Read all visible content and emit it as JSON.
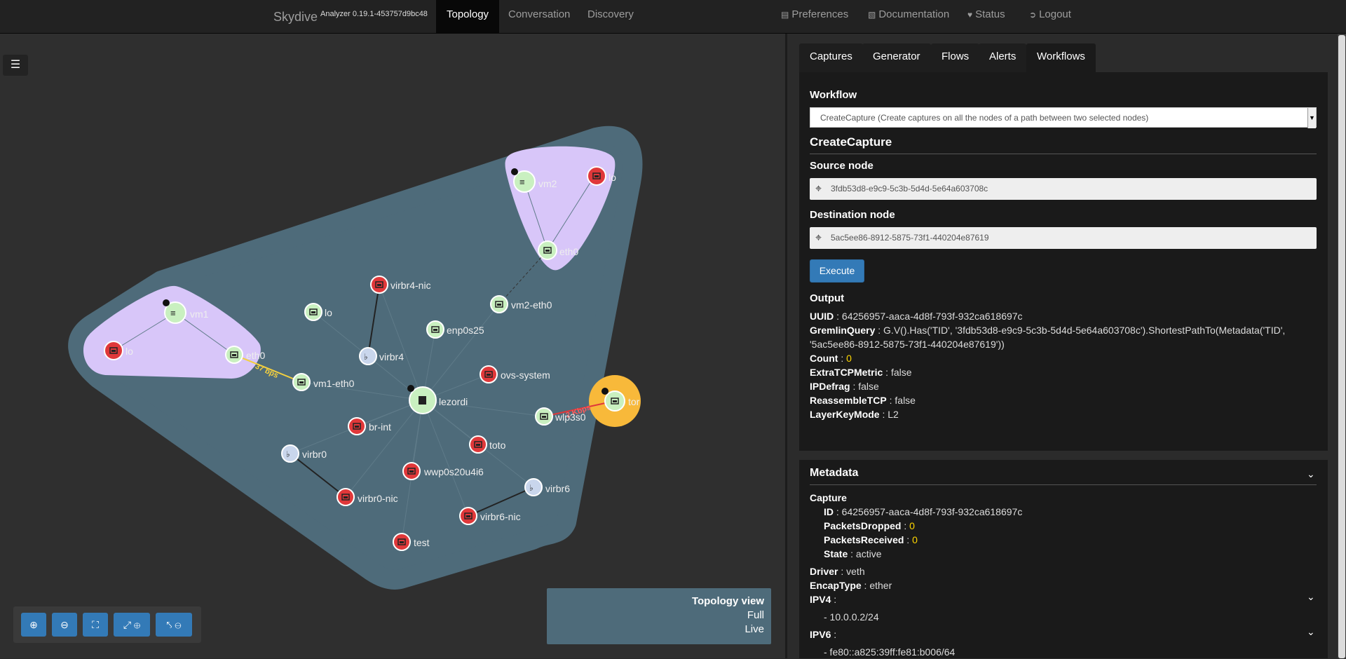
{
  "nav": {
    "brand": "Skydive",
    "version": "Analyzer 0.19.1-453757d9bc48",
    "tabs": [
      "Topology",
      "Conversation",
      "Discovery"
    ],
    "right": [
      {
        "icon": "preferences-icon",
        "label": "Preferences"
      },
      {
        "icon": "documentation-icon",
        "label": "Documentation"
      },
      {
        "icon": "status-icon",
        "label": "Status"
      },
      {
        "icon": "logout-icon",
        "label": "Logout"
      }
    ]
  },
  "topology": {
    "nodes": {
      "vm2": "vm2",
      "lo_vm2": "lo",
      "eth0_vm2": "eth0",
      "vm2_eth0": "vm2-eth0",
      "vm1": "vm1",
      "lo_vm1": "lo",
      "eth0_vm1": "eth0",
      "virbr4_nic": "virbr4-nic",
      "lo_host": "lo",
      "virbr4": "virbr4",
      "enp0s25": "enp0s25",
      "vm1_eth0": "vm1-eth0",
      "lezordi": "lezordi",
      "ovs_system": "ovs-system",
      "br_int": "br-int",
      "toto": "toto",
      "wlp3s0": "wlp3s0",
      "tor": "tor",
      "virbr0": "virbr0",
      "wwp0s20u4i6": "wwp0s20u4i6",
      "virbr0_nic": "virbr0-nic",
      "virbr6": "virbr6",
      "virbr6_nic": "virbr6-nic",
      "test": "test"
    },
    "link_labels": {
      "vm1_rate": "37 bps",
      "tor_rate": "2 Kbps"
    },
    "colors": {
      "hull": "#4e6b7a",
      "vm_group": "#d8c6f9",
      "tor_group": "#f8b93a",
      "interface_down": "#e0383a",
      "interface_up": "#c9f0c0",
      "bridge": "#c9d6ec"
    }
  },
  "zoom_controls": [
    "zoom-in-icon",
    "zoom-out-icon",
    "fit-icon",
    "expand-all-icon",
    "collapse-all-icon"
  ],
  "legend": {
    "title": "Topology view",
    "line1": "Full",
    "line2": "Live"
  },
  "panel": {
    "tabs": [
      "Captures",
      "Generator",
      "Flows",
      "Alerts",
      "Workflows"
    ],
    "workflow_label": "Workflow",
    "workflow_selected": "CreateCapture (Create captures on all the nodes of a path between two selected nodes)",
    "section_title": "CreateCapture",
    "source_label": "Source node",
    "source_value": "3fdb53d8-e9c9-5c3b-5d4d-5e64a603708c",
    "dest_label": "Destination node",
    "dest_value": "5ac5ee86-8912-5875-73f1-440204e87619",
    "execute": "Execute",
    "output_label": "Output",
    "output": {
      "uuid_k": "UUID",
      "uuid_v": "64256957-aaca-4d8f-793f-932ca618697c",
      "gremlin_k": "GremlinQuery",
      "gremlin_v1": "G.V().Has('TID', '3fdb53d8-e9c9-5c3b-5d4d-5e64a603708c').ShortestPathTo(Metadata('TID',",
      "gremlin_v2": "'5ac5ee86-8912-5875-73f1-440204e87619'))",
      "count_k": "Count",
      "count_v": "0",
      "extra_k": "ExtraTCPMetric",
      "extra_v": "false",
      "ipdefrag_k": "IPDefrag",
      "ipdefrag_v": "false",
      "reasm_k": "ReassembleTCP",
      "reasm_v": "false",
      "layer_k": "LayerKeyMode",
      "layer_v": "L2"
    },
    "metadata": {
      "title": "Metadata",
      "capture_k": "Capture",
      "id_k": "ID",
      "id_v": "64256957-aaca-4d8f-793f-932ca618697c",
      "dropped_k": "PacketsDropped",
      "dropped_v": "0",
      "received_k": "PacketsReceived",
      "received_v": "0",
      "state_k": "State",
      "state_v": "active",
      "driver_k": "Driver",
      "driver_v": "veth",
      "encap_k": "EncapType",
      "encap_v": "ether",
      "ipv4_k": "IPV4",
      "ipv4_v": "- 10.0.0.2/24",
      "ipv6_k": "IPV6",
      "ipv6_v": "- fe80::a825:39ff:fe81:b006/64"
    }
  }
}
